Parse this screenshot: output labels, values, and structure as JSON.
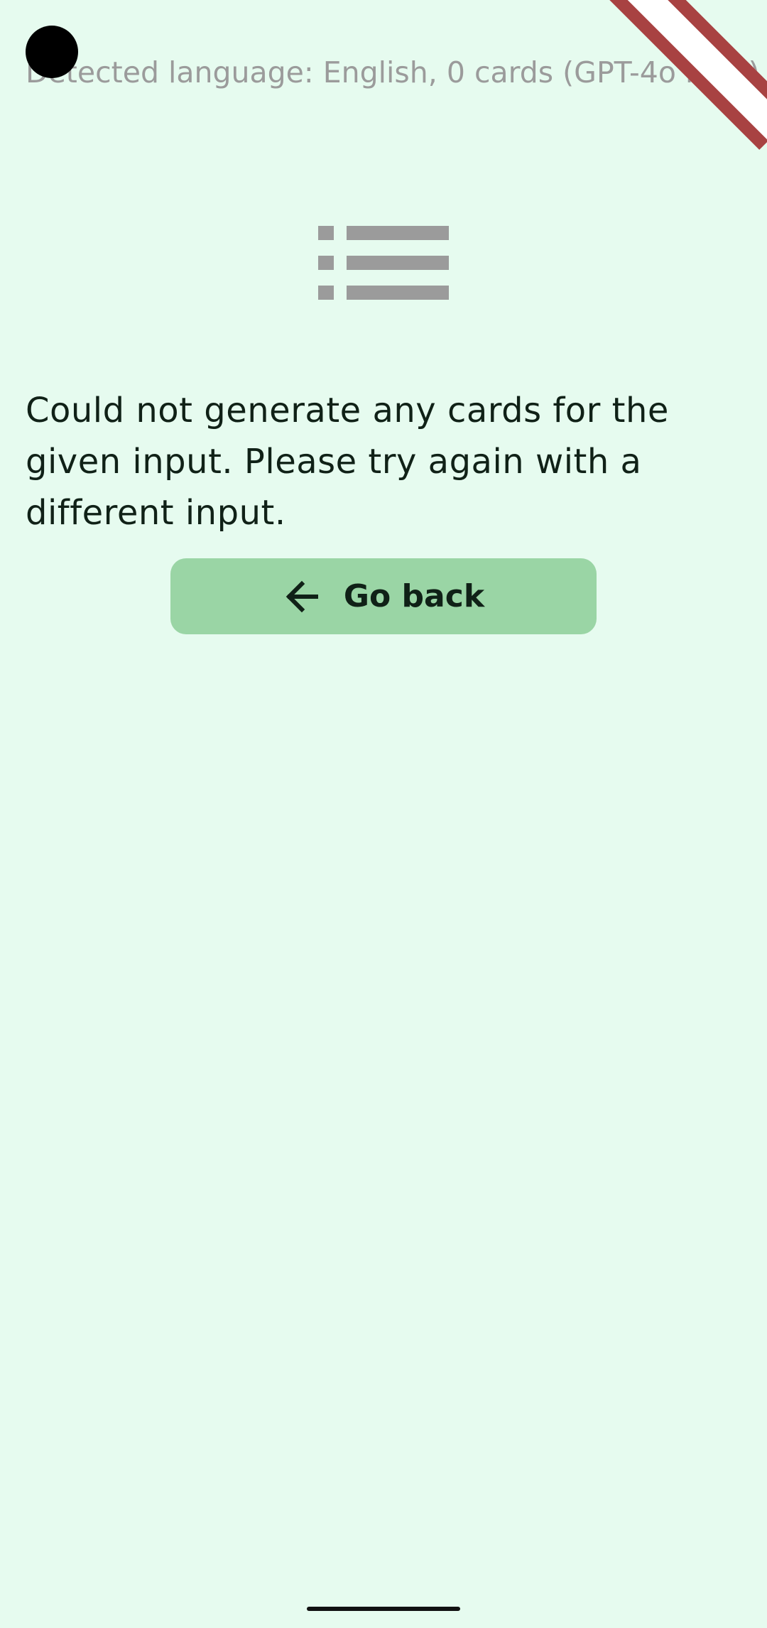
{
  "header": {
    "detected_language": "Detected language: English, 0 cards (GPT-4o mini)"
  },
  "empty_state": {
    "icon": "list-icon",
    "message": "Could not generate any cards for the given input. Please try again with a different input."
  },
  "actions": {
    "go_back_label": "Go back",
    "go_back_icon": "arrow-left-icon"
  },
  "colors": {
    "background": "#e6fbef",
    "button": "#9ad5a5",
    "text": "#102117",
    "muted": "#9b9b9b",
    "debug_ribbon": "#a84242"
  }
}
